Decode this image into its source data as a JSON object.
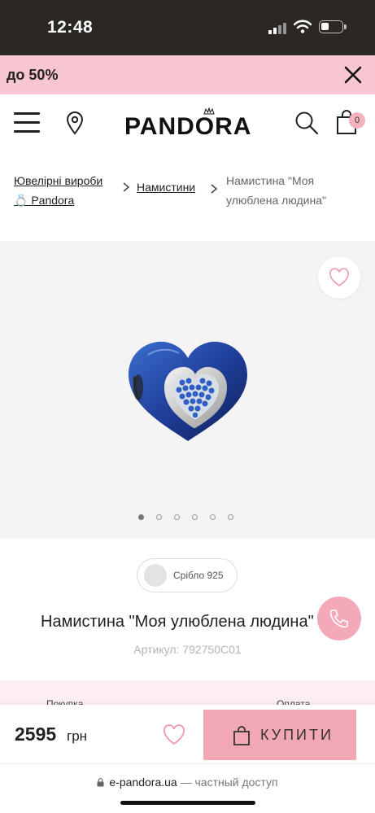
{
  "status_bar": {
    "time": "12:48"
  },
  "promo": {
    "text": "до 50%"
  },
  "header": {
    "logo": "PANDORA",
    "cart_count": "0"
  },
  "breadcrumb": {
    "items": [
      "Ювелірні вироби 💍 Pandora",
      "Намистини",
      "Намистина \"Моя улюблена людина\""
    ]
  },
  "gallery": {
    "slide_count": 6,
    "active_slide": 1
  },
  "product": {
    "material": "Срібло 925",
    "title": "Намистина \"Моя улюблена людина\"",
    "sku_label": "Артикул:",
    "sku": "792750C01"
  },
  "info_strip": {
    "left": "Покупка",
    "right": "Оплата"
  },
  "buy_bar": {
    "price": "2595",
    "currency": "грн",
    "buy_label": "КУПИТИ"
  },
  "browser": {
    "domain": "e-pandora.ua",
    "note": "— частный доступ"
  },
  "colors": {
    "promo_bg": "#f8c6d0",
    "accent_pink": "#f2a7b5",
    "status_bar_bg": "#2b2824"
  }
}
